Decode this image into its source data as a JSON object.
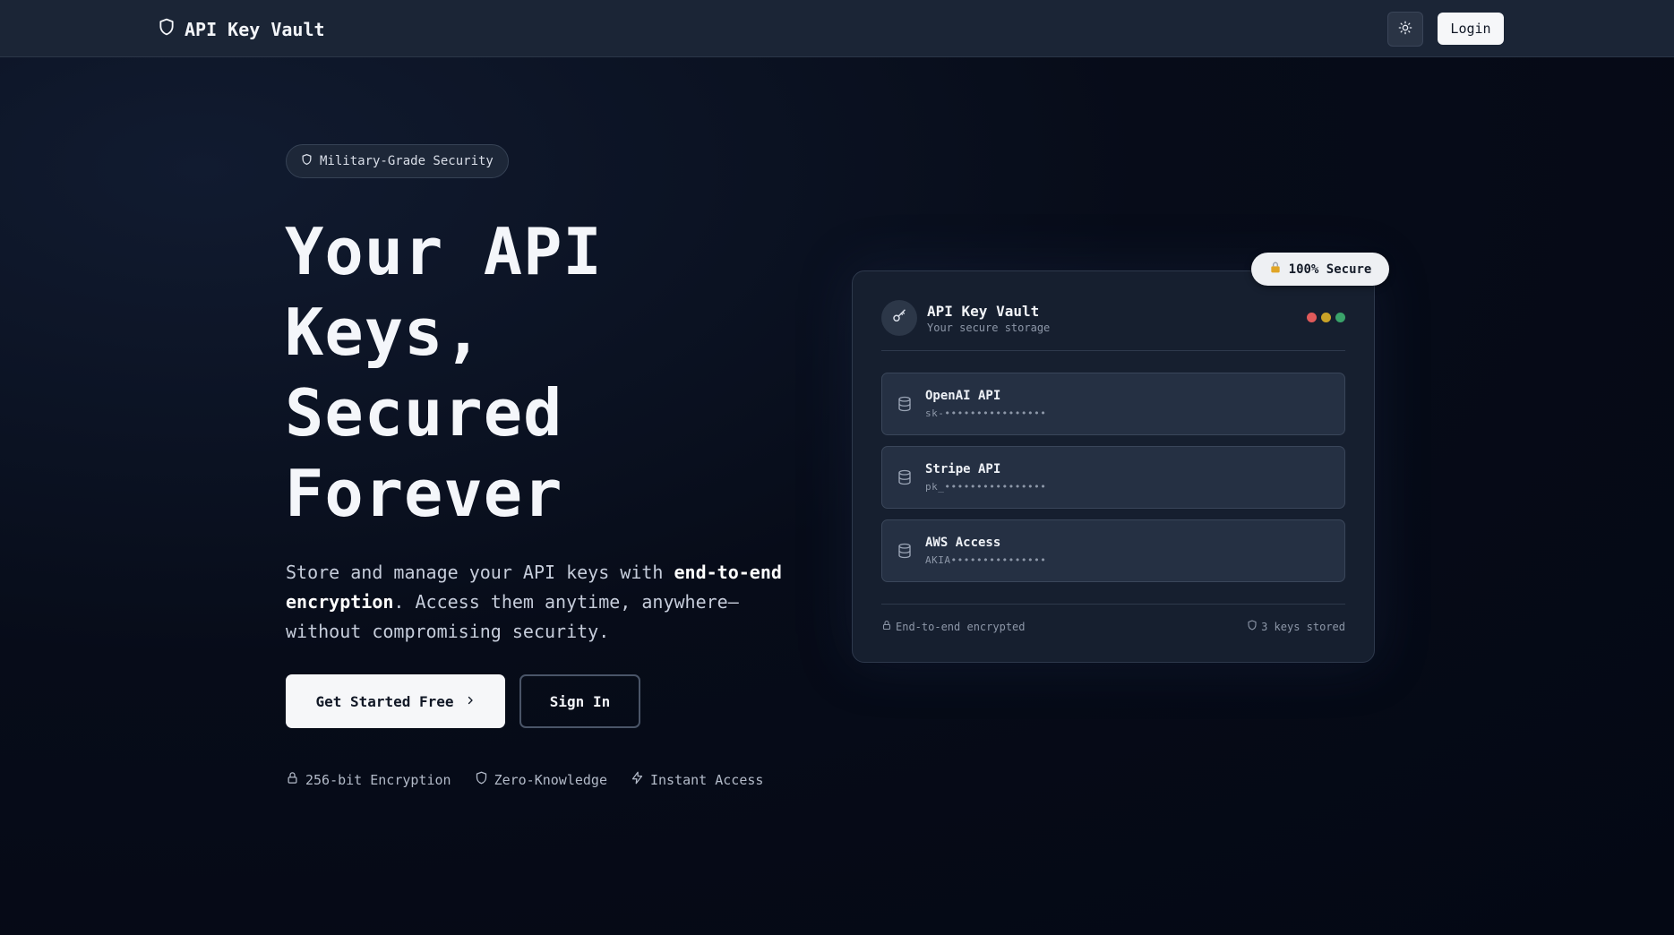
{
  "nav": {
    "brand": "API Key Vault",
    "login_label": "Login"
  },
  "hero": {
    "badge": "Military-Grade Security",
    "title_lines": [
      "Your API",
      "Keys,",
      "Secured",
      "Forever"
    ],
    "desc_part1": "Store and manage your API keys with ",
    "desc_bold": "end-to-end encryption",
    "desc_part2": ". Access them anytime, anywhere—without compromising security.",
    "cta_primary": "Get Started Free",
    "cta_secondary": "Sign In",
    "features": [
      "256-bit Encryption",
      "Zero-Knowledge",
      "Instant Access"
    ]
  },
  "card": {
    "secure_pill": "100% Secure",
    "title": "API Key Vault",
    "subtitle": "Your secure storage",
    "dot_colors": [
      "#e05a5a",
      "#c9a227",
      "#3aa36a"
    ],
    "keys": [
      {
        "name": "OpenAI API",
        "value": "sk-••••••••••••••••"
      },
      {
        "name": "Stripe API",
        "value": "pk_••••••••••••••••"
      },
      {
        "name": "AWS Access",
        "value": "AKIA•••••••••••••••"
      }
    ],
    "footer_left": "End-to-end encrypted",
    "footer_right": "3 keys stored"
  }
}
